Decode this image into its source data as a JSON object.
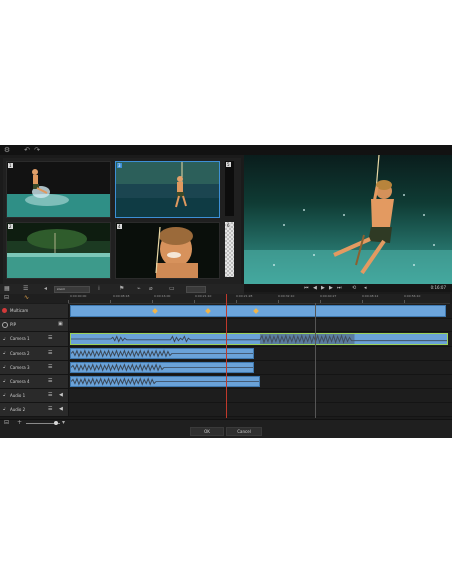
{
  "toolbar": {
    "settings_icon": "gear-icon",
    "undo_icon": "undo-icon",
    "redo_icon": "redo-icon"
  },
  "source_monitors": {
    "cameras": [
      {
        "number": "1",
        "selected": false
      },
      {
        "number": "2",
        "selected": false
      },
      {
        "number": "3",
        "selected": true
      },
      {
        "number": "4",
        "selected": false
      }
    ],
    "extra_slots": [
      {
        "number": "5"
      },
      {
        "number": "6"
      }
    ]
  },
  "transport": {
    "timecode": "0:16:07",
    "buttons": [
      "skip-start-icon",
      "step-back-icon",
      "play-icon",
      "step-forward-icon",
      "skip-end-icon",
      "loop-icon",
      "volume-icon"
    ]
  },
  "timeline_toolbar": {
    "select_value": "zoom"
  },
  "ruler": {
    "labels": [
      "0:00:00:00",
      "0:00:08:18",
      "0:00:16:00",
      "0:00:21:10",
      "0:00:21:28",
      "0:00:32:10",
      "0:00:40:27",
      "0:00:48:12",
      "0:00:56:10"
    ]
  },
  "tracks": {
    "multicam": {
      "name": "Multicam"
    },
    "pip": {
      "name": "PIP"
    },
    "camera1": {
      "name": "Camera 1"
    },
    "camera2": {
      "name": "Camera 2"
    },
    "camera3": {
      "name": "Camera 3"
    },
    "camera4": {
      "name": "Camera 4"
    },
    "audio1": {
      "name": "Audio 1"
    },
    "audio2": {
      "name": "Audio 2"
    }
  },
  "footer": {
    "ok_label": "OK",
    "cancel_label": "Cancel"
  },
  "colors": {
    "accent": "#3d8fd6",
    "clip": "#6aa2d8",
    "playhead": "#c0392b",
    "marker": "#f0b44a"
  }
}
